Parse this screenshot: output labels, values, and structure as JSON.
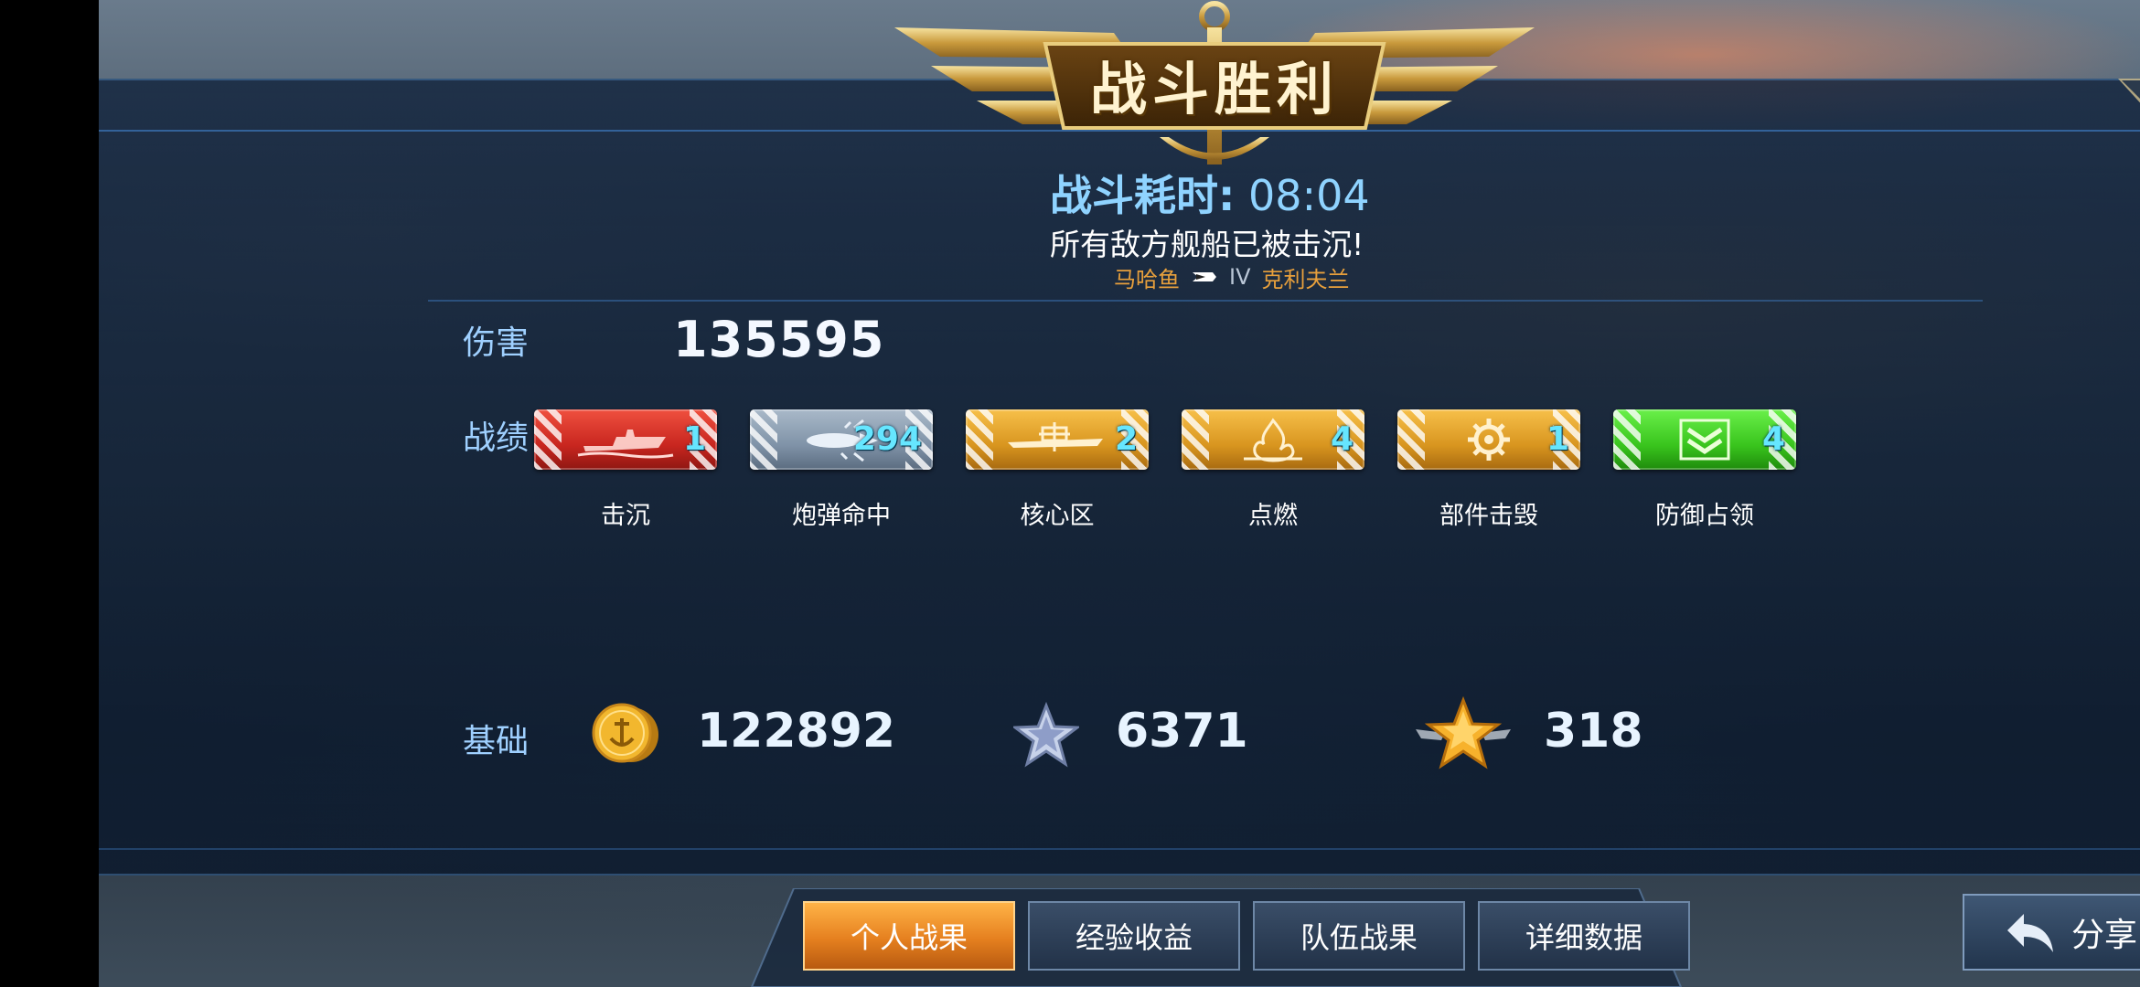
{
  "header": {
    "title": "战斗胜利",
    "duration_label": "战斗耗时:",
    "duration_value": "08:04",
    "result_message": "所有敌方舰船已被击沉!",
    "ship_class": "马哈鱼",
    "ship_tier": "IV",
    "ship_name": "克利夫兰"
  },
  "damage": {
    "label": "伤害",
    "value": "135595"
  },
  "achievements": {
    "label": "战绩",
    "items": [
      {
        "label": "击沉",
        "count": "1",
        "color": "red",
        "icon": "ship-sinking-icon"
      },
      {
        "label": "炮弹命中",
        "count": "294",
        "color": "steel",
        "icon": "shell-hit-icon"
      },
      {
        "label": "核心区",
        "count": "2",
        "color": "gold",
        "icon": "citadel-icon"
      },
      {
        "label": "点燃",
        "count": "4",
        "color": "gold",
        "icon": "fire-icon"
      },
      {
        "label": "部件击毁",
        "count": "1",
        "color": "gold",
        "icon": "gear-icon"
      },
      {
        "label": "防御占领",
        "count": "4",
        "color": "green",
        "icon": "chevron-shield-icon"
      }
    ]
  },
  "base": {
    "label": "基础",
    "credits": "122892",
    "experience": "6371",
    "commander_xp": "318"
  },
  "tabs": [
    {
      "label": "个人战果",
      "active": true
    },
    {
      "label": "经验收益",
      "active": false
    },
    {
      "label": "队伍战果",
      "active": false
    },
    {
      "label": "详细数据",
      "active": false
    }
  ],
  "share_label": "分享",
  "colors": {
    "accent_blue": "#8fd3ff",
    "count_cyan": "#66e6ff",
    "gold": "#e8a03c",
    "badge_red": "#d83028",
    "badge_steel": "#8d9fb3",
    "badge_gold": "#e2a12b",
    "badge_green": "#39c41d"
  }
}
